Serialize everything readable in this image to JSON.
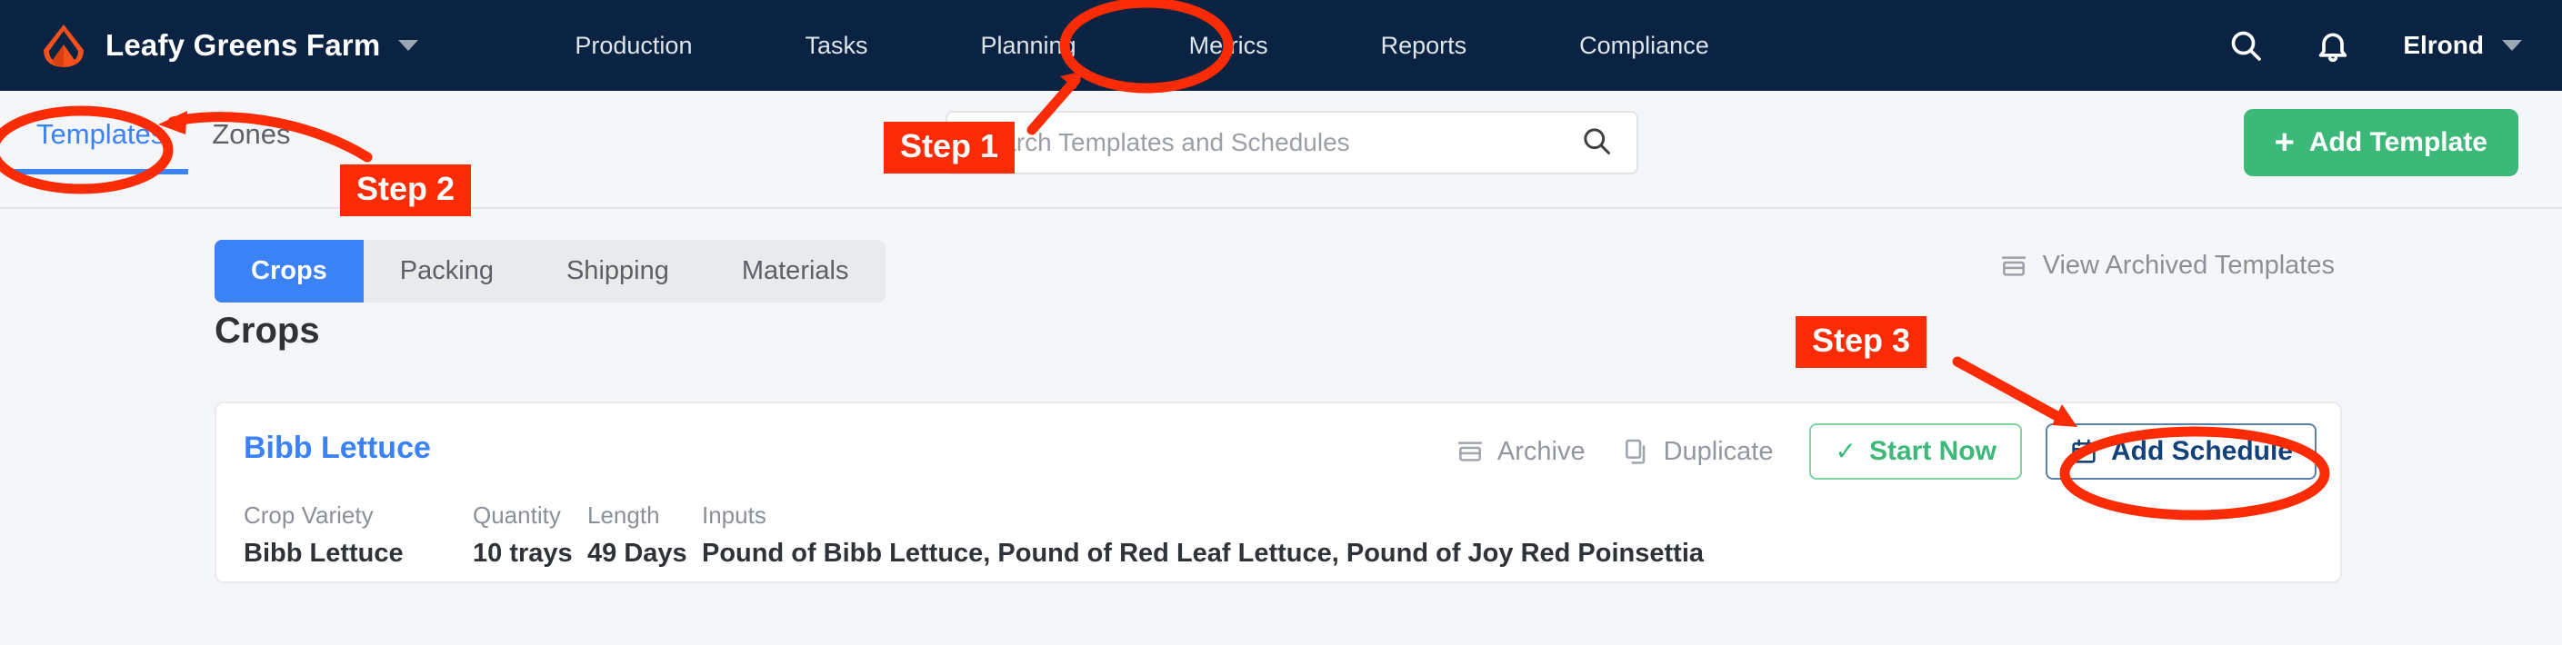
{
  "topbar": {
    "logo_icon": "leaf-logo-icon",
    "brand": "Leafy Greens Farm",
    "brand_caret_icon": "chevron-down-icon",
    "nav": [
      {
        "label": "Production"
      },
      {
        "label": "Tasks"
      },
      {
        "label": "Planning"
      },
      {
        "label": "Metrics"
      },
      {
        "label": "Reports"
      },
      {
        "label": "Compliance"
      }
    ],
    "search_icon": "search-icon",
    "bell_icon": "bell-icon",
    "user": "Elrond",
    "user_caret_icon": "chevron-down-icon",
    "background_color": "#0a2342"
  },
  "subbar": {
    "tabs": [
      {
        "label": "Templates",
        "active": true
      },
      {
        "label": "Zones",
        "active": false
      }
    ],
    "search": {
      "placeholder": "Search Templates and Schedules",
      "value": "",
      "icon": "search-icon"
    },
    "add_template": {
      "label": "Add Template",
      "plus": "+",
      "color": "#3cb878"
    }
  },
  "main": {
    "segmented": [
      {
        "label": "Crops",
        "active": true
      },
      {
        "label": "Packing",
        "active": false
      },
      {
        "label": "Shipping",
        "active": false
      },
      {
        "label": "Materials",
        "active": false
      }
    ],
    "view_archived": {
      "label": "View Archived Templates",
      "icon": "archive-icon"
    },
    "page_title": "Crops",
    "card": {
      "title": "Bibb Lettuce",
      "actions": {
        "archive": {
          "label": "Archive",
          "icon": "archive-icon"
        },
        "duplicate": {
          "label": "Duplicate",
          "icon": "copy-icon"
        },
        "start_now": {
          "label": "Start Now",
          "icon": "check-icon",
          "color": "#3cb878"
        },
        "add_schedule": {
          "label": "Add Schedule",
          "icon": "calendar-icon",
          "color": "#13417a"
        }
      },
      "details": [
        {
          "label": "Crop Variety",
          "value": "Bibb Lettuce"
        },
        {
          "label": "Quantity",
          "value": "10 trays"
        },
        {
          "label": "Length",
          "value": "49 Days"
        },
        {
          "label": "Inputs",
          "value": "Pound of Bibb Lettuce, Pound of Red Leaf Lettuce, Pound of Joy Red Poinsettia"
        }
      ]
    }
  },
  "annotations": {
    "color": "#fb2c05",
    "steps": [
      {
        "label": "Step 1",
        "target": "nav-link-planning"
      },
      {
        "label": "Step 2",
        "target": "subtab-templates"
      },
      {
        "label": "Step 3",
        "target": "add-schedule-button"
      }
    ]
  }
}
